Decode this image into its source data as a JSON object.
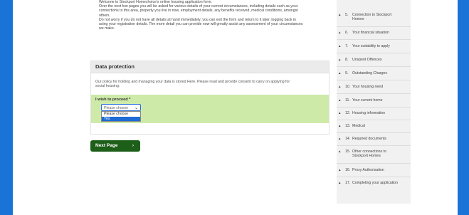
{
  "intro": {
    "lines": [
      "Welcome to Stockport Homechoice's online housing application form.",
      "Over the next few pages you will be asked for various details of your current circumstances, including details such as your",
      "connections to this area, property you live in now, employment details, any benefits received, medical conditions, amongst",
      "others.",
      "Do not worry if you do not have all details at hand immediately, you can exit the form and return to it later, logging back in",
      "using your registration details. The more detail you can provide now will greatly assist any assessment of your circumstances",
      "we make."
    ]
  },
  "data_protection": {
    "title": "Data protection",
    "text_lines": [
      "Our policy for holding and managing your data is stored Here. Please read and provide consent to carry on applying for",
      "social housing."
    ],
    "proceed_label": "I wish to proceed *",
    "select_value": "Please choose",
    "options": [
      "Please choose",
      "Yes"
    ],
    "selected_option_index": 1
  },
  "next_button": {
    "label": "Next Page",
    "arrow": "›"
  },
  "sidebar": {
    "items": [
      {
        "num": "5.",
        "label": "Connection to Stockport Homes"
      },
      {
        "num": "6.",
        "label": "Your financial situation"
      },
      {
        "num": "7.",
        "label": "Your suitability to apply"
      },
      {
        "num": "8.",
        "label": "Unspent Offences"
      },
      {
        "num": "9.",
        "label": "Outstanding Charges"
      },
      {
        "num": "10.",
        "label": "Your housing need"
      },
      {
        "num": "11.",
        "label": "Your current home"
      },
      {
        "num": "12.",
        "label": "Housing information"
      },
      {
        "num": "13.",
        "label": "Medical"
      },
      {
        "num": "14.",
        "label": "Required documents"
      },
      {
        "num": "15.",
        "label": "Other connections to Stockport Homes"
      },
      {
        "num": "16.",
        "label": "Proxy Authorisation"
      },
      {
        "num": "17.",
        "label": "Completing your application"
      }
    ],
    "bullet": "▲"
  },
  "colors": {
    "outer_border": "#1a73d6",
    "proceed_bg": "#cdeaa9",
    "next_button_bg": "#1d5e19",
    "selected_option_bg": "#1e6bd6",
    "sidebar_bg": "#f1f1f1"
  }
}
